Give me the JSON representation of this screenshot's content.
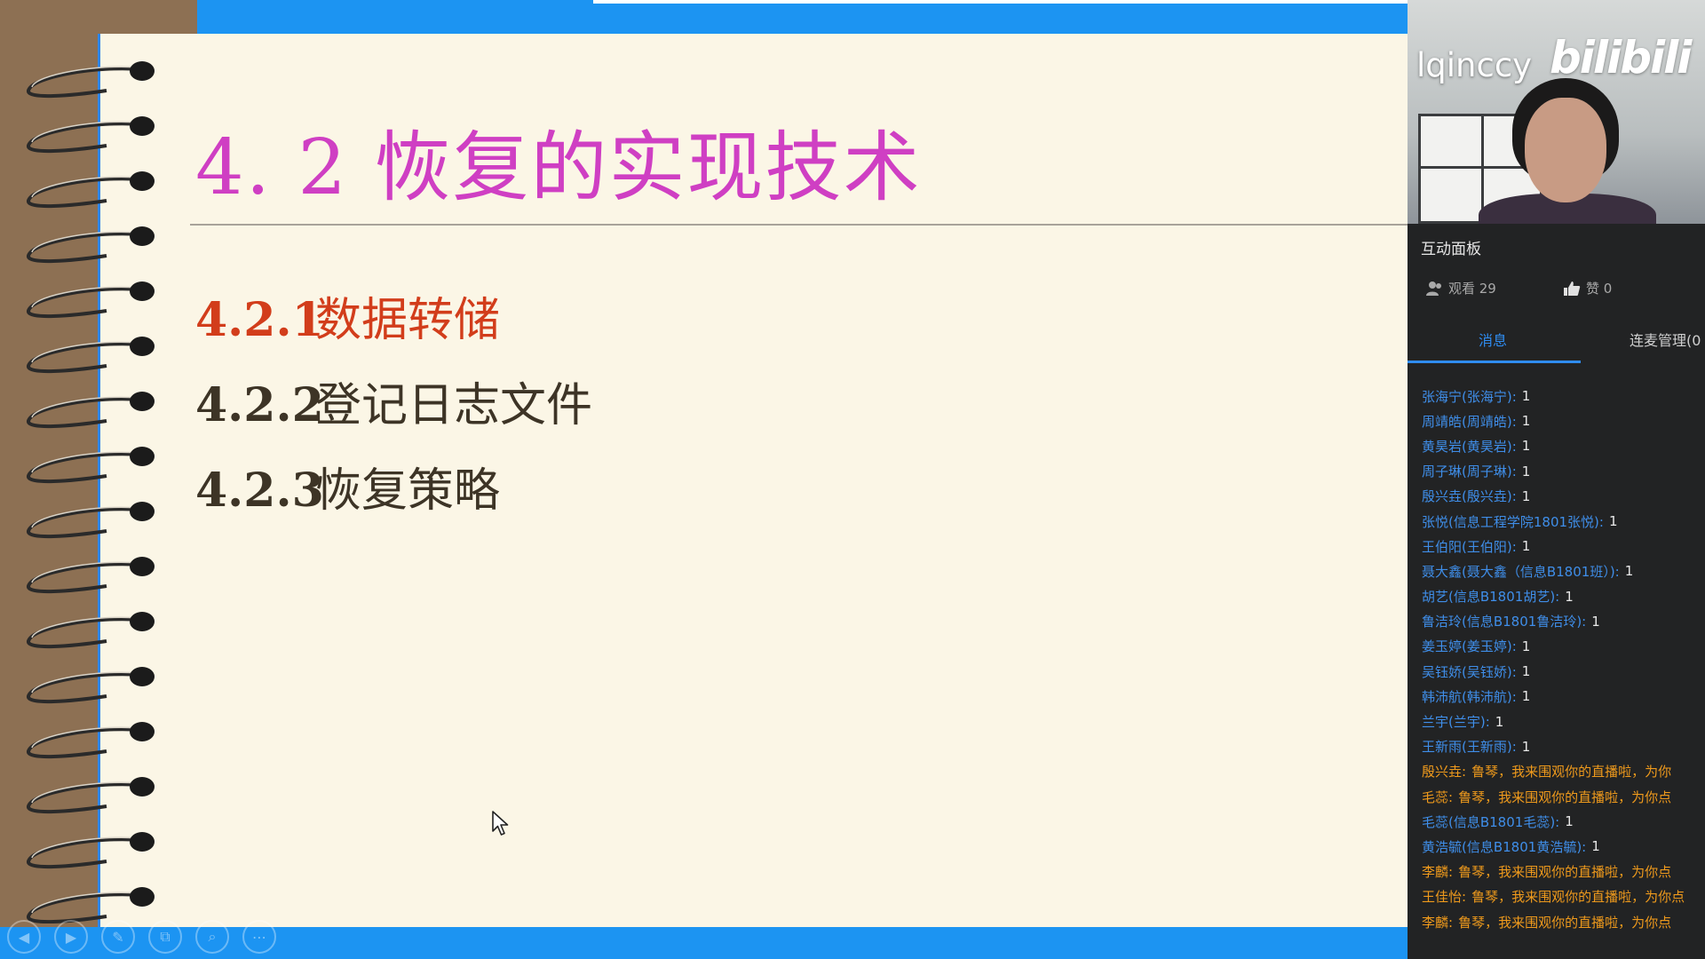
{
  "slide": {
    "title": "4. 2  恢复的实现技术",
    "items": [
      {
        "number": "4.2.1",
        "text": "数据转储",
        "active": true
      },
      {
        "number": "4.2.2",
        "text": "登记日志文件",
        "active": false
      },
      {
        "number": "4.2.3",
        "text": "恢复策略",
        "active": false
      }
    ],
    "colors": {
      "title": "#cf3fc3",
      "active_item": "#d23d1b",
      "item": "#3d3426",
      "frame": "#1c94f2"
    }
  },
  "player_controls": [
    {
      "icon": "prev-icon",
      "glyph": "◀"
    },
    {
      "icon": "next-icon",
      "glyph": "▶"
    },
    {
      "icon": "pen-icon",
      "glyph": "✎"
    },
    {
      "icon": "copy-icon",
      "glyph": "⧉"
    },
    {
      "icon": "zoom-icon",
      "glyph": "⌕"
    },
    {
      "icon": "more-icon",
      "glyph": "⋯"
    }
  ],
  "webcam": {
    "streamer": "lqinccy",
    "brand": "bilibili"
  },
  "panel": {
    "title": "互动面板",
    "viewers_label": "观看 29",
    "likes_label": "赞 0",
    "tabs": {
      "messages": "消息",
      "cohost": "连麦管理(0"
    },
    "messages": [
      {
        "who": "张海宁(张海宁):",
        "what": "1",
        "type": "normal"
      },
      {
        "who": "周靖皓(周靖皓):",
        "what": "1",
        "type": "normal"
      },
      {
        "who": "黄昊岩(黄昊岩):",
        "what": "1",
        "type": "normal"
      },
      {
        "who": "周子琳(周子琳):",
        "what": "1",
        "type": "normal"
      },
      {
        "who": "殷兴垚(殷兴垚):",
        "what": "1",
        "type": "normal"
      },
      {
        "who": "张悦(信息工程学院1801张悦):",
        "what": "1",
        "type": "normal"
      },
      {
        "who": "王伯阳(王伯阳):",
        "what": "1",
        "type": "normal"
      },
      {
        "who": "聂大鑫(聂大鑫（信息B1801班）):",
        "what": "1",
        "type": "normal"
      },
      {
        "who": "胡艺(信息B1801胡艺):",
        "what": "1",
        "type": "normal"
      },
      {
        "who": "鲁洁玲(信息B1801鲁洁玲):",
        "what": "1",
        "type": "normal"
      },
      {
        "who": "姜玉婷(姜玉婷):",
        "what": "1",
        "type": "normal"
      },
      {
        "who": "吴钰娇(吴钰娇):",
        "what": "1",
        "type": "normal"
      },
      {
        "who": "韩沛航(韩沛航):",
        "what": "1",
        "type": "normal"
      },
      {
        "who": "兰宇(兰宇):",
        "what": "1",
        "type": "normal"
      },
      {
        "who": "王新雨(王新雨):",
        "what": "1",
        "type": "normal"
      },
      {
        "who": "殷兴垚:",
        "what": "鲁琴，我来围观你的直播啦，为你",
        "type": "greet"
      },
      {
        "who": "毛蕊:",
        "what": "鲁琴，我来围观你的直播啦，为你点",
        "type": "greet"
      },
      {
        "who": "毛蕊(信息B1801毛蕊):",
        "what": "1",
        "type": "normal"
      },
      {
        "who": "黄浩毓(信息B1801黄浩毓):",
        "what": "1",
        "type": "normal"
      },
      {
        "who": "李麟:",
        "what": "鲁琴，我来围观你的直播啦，为你点",
        "type": "greet"
      },
      {
        "who": "王佳怡:",
        "what": "鲁琴，我来围观你的直播啦，为你点",
        "type": "greet"
      },
      {
        "who": "李麟:",
        "what": "鲁琴，我来围观你的直播啦，为你点",
        "type": "greet"
      }
    ]
  }
}
